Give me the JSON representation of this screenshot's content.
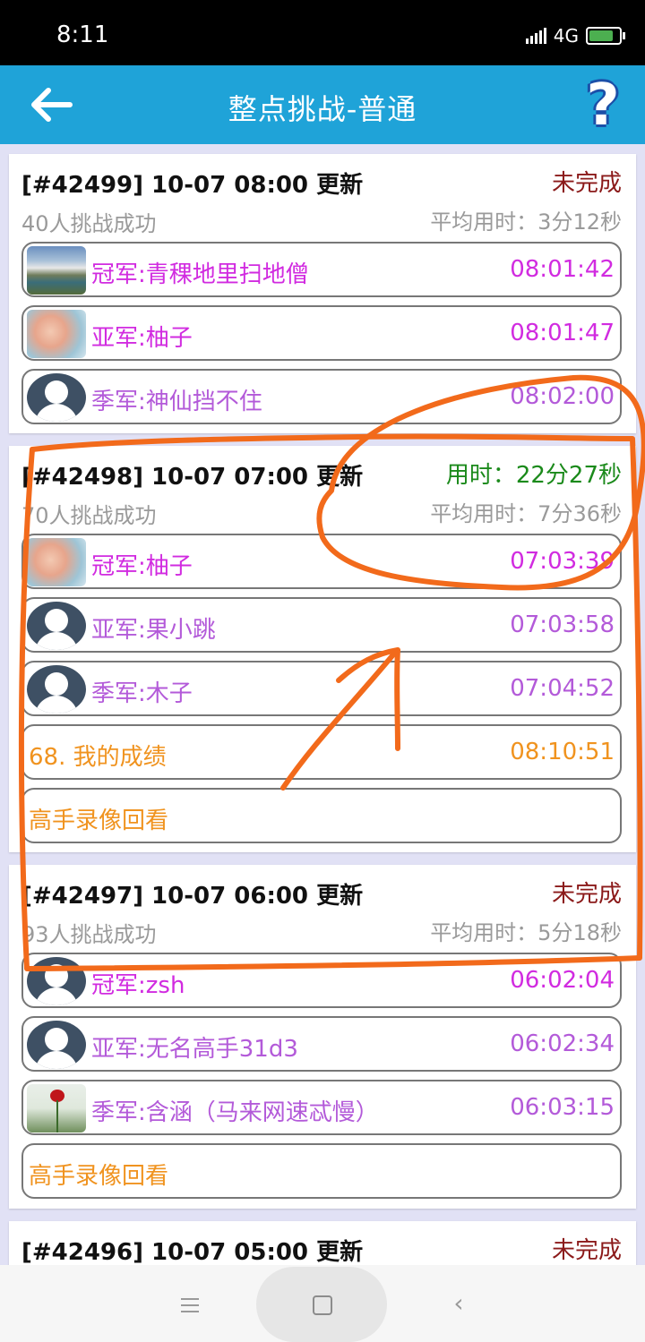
{
  "status_bar": {
    "time": "8:11",
    "network": "4G"
  },
  "header": {
    "title": "整点挑战-普通"
  },
  "cards": [
    {
      "head": "[#42499] 10-07 08:00 更新",
      "status": "未完成",
      "status_color": "#8b1a1a",
      "success": "40人挑战成功",
      "avg": "平均用时：3分12秒",
      "rows": [
        {
          "label": "冠军:青稞地里扫地僧",
          "time": "08:01:42"
        },
        {
          "label": "亚军:柚子",
          "time": "08:01:47"
        },
        {
          "label": "季军:神仙挡不住",
          "time": "08:02:00"
        }
      ]
    },
    {
      "head": "[#42498] 10-07 07:00 更新",
      "status": "用时：22分27秒",
      "status_color": "#1b8a1b",
      "success": "70人挑战成功",
      "avg": "平均用时：7分36秒",
      "rows": [
        {
          "label": "冠军:柚子",
          "time": "07:03:39"
        },
        {
          "label": "亚军:果小跳",
          "time": "07:03:58"
        },
        {
          "label": "季军:木子",
          "time": "07:04:52"
        },
        {
          "label": "68. 我的成绩",
          "time": "08:10:51"
        },
        {
          "label": "高手录像回看",
          "time": ""
        }
      ]
    },
    {
      "head": "[#42497] 10-07 06:00 更新",
      "status": "未完成",
      "status_color": "#8b1a1a",
      "success": "93人挑战成功",
      "avg": "平均用时：5分18秒",
      "rows": [
        {
          "label": "冠军:zsh",
          "time": "06:02:04"
        },
        {
          "label": "亚军:无名高手31d3",
          "time": "06:02:34"
        },
        {
          "label": "季军:含涵（马来网速忒慢）",
          "time": "06:03:15"
        },
        {
          "label": "高手录像回看",
          "time": ""
        }
      ]
    },
    {
      "head": "[#42496] 10-07 05:00 更新",
      "status": "未完成",
      "status_color": "#8b1a1a"
    }
  ]
}
